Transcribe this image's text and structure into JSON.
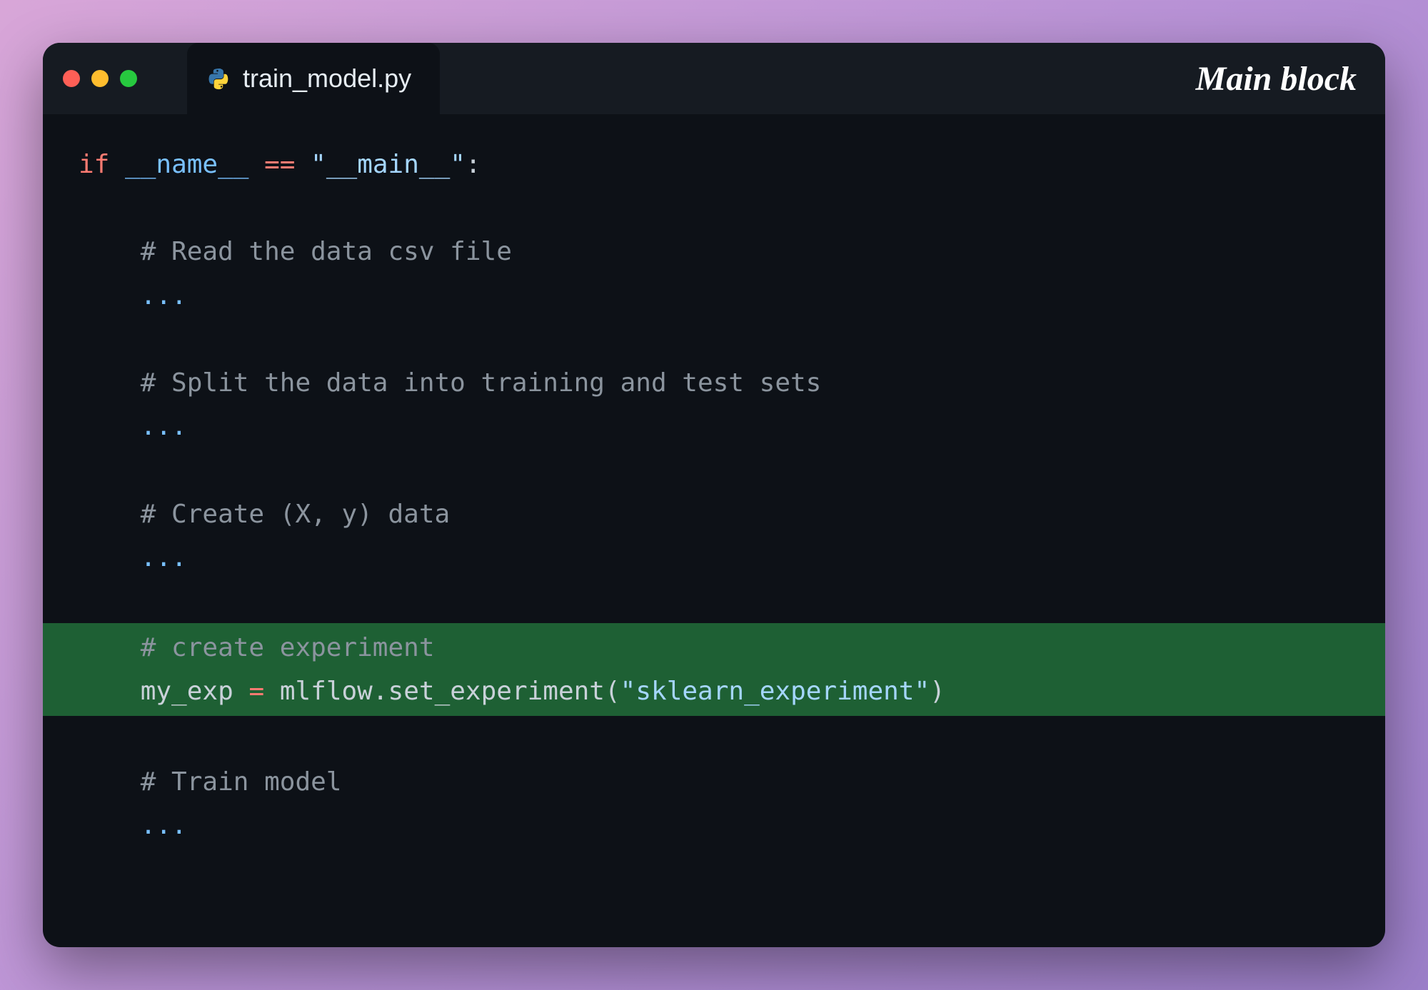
{
  "window": {
    "title": "Main block"
  },
  "tab": {
    "filename": "train_model.py"
  },
  "code": {
    "line1": {
      "keyword": "if",
      "variable": "__name__",
      "operator": "==",
      "string": "\"__main__\"",
      "punct": ":"
    },
    "comment1": "# Read the data csv file",
    "ellipsis1": "...",
    "comment2": "# Split the data into training and test sets",
    "ellipsis2": "...",
    "comment3": "# Create (X, y) data",
    "ellipsis3": "...",
    "highlight": {
      "comment": "# create experiment",
      "assign_var": "my_exp",
      "assign_op": "=",
      "call_obj": "mlflow",
      "call_dot": ".",
      "call_func": "set_experiment",
      "call_open": "(",
      "call_arg": "\"sklearn_experiment\"",
      "call_close": ")"
    },
    "comment5": "# Train model",
    "ellipsis4": "..."
  }
}
